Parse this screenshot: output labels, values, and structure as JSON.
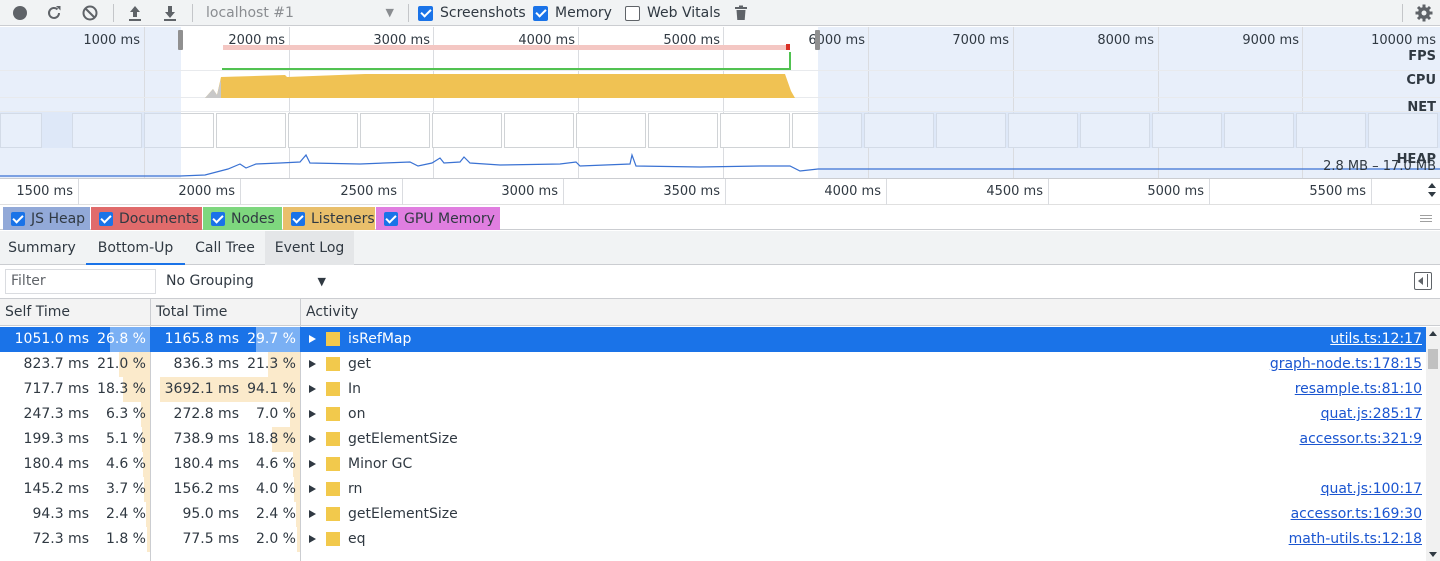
{
  "toolbar": {
    "profile_select": "localhost #1",
    "checkboxes": [
      {
        "label": "Screenshots",
        "checked": true
      },
      {
        "label": "Memory",
        "checked": true
      },
      {
        "label": "Web Vitals",
        "checked": false
      }
    ],
    "icons": [
      "record-icon",
      "reload-icon",
      "clear-icon",
      "upload-icon",
      "download-icon",
      "trash-icon",
      "gear-icon"
    ]
  },
  "overview": {
    "tick_labels": [
      "1000 ms",
      "2000 ms",
      "3000 ms",
      "4000 ms",
      "5000 ms",
      "6000 ms",
      "7000 ms",
      "8000 ms",
      "9000 ms",
      "10000 ms"
    ],
    "tracks": [
      "FPS",
      "CPU",
      "NET",
      "HEAP"
    ],
    "heap_range": "2.8 MB – 17.0 MB"
  },
  "ruler": {
    "labels": [
      "1500 ms",
      "2000 ms",
      "2500 ms",
      "3000 ms",
      "3500 ms",
      "4000 ms",
      "4500 ms",
      "5000 ms",
      "5500 ms"
    ]
  },
  "counters": [
    {
      "label": "JS Heap",
      "color": "#92a9d8"
    },
    {
      "label": "Documents",
      "color": "#e06b6b"
    },
    {
      "label": "Nodes",
      "color": "#7ed77e"
    },
    {
      "label": "Listeners",
      "color": "#e9bf6b"
    },
    {
      "label": "GPU Memory",
      "color": "#e07ee0"
    }
  ],
  "tabs": [
    "Summary",
    "Bottom-Up",
    "Call Tree",
    "Event Log"
  ],
  "active_tab": "Bottom-Up",
  "filter": {
    "placeholder": "Filter"
  },
  "grouping": "No Grouping",
  "columns": {
    "self": "Self Time",
    "total": "Total Time",
    "activity": "Activity"
  },
  "rows": [
    {
      "self_ms": "1051.0 ms",
      "self_pct": "26.8 %",
      "self_frac": 0.268,
      "total_ms": "1165.8 ms",
      "total_pct": "29.7 %",
      "total_frac": 0.297,
      "name": "isRefMap",
      "link": "utils.ts:12:17",
      "selected": true
    },
    {
      "self_ms": "823.7 ms",
      "self_pct": "21.0 %",
      "self_frac": 0.21,
      "total_ms": "836.3 ms",
      "total_pct": "21.3 %",
      "total_frac": 0.213,
      "name": "get",
      "link": "graph-node.ts:178:15"
    },
    {
      "self_ms": "717.7 ms",
      "self_pct": "18.3 %",
      "self_frac": 0.183,
      "total_ms": "3692.1 ms",
      "total_pct": "94.1 %",
      "total_frac": 0.941,
      "name": "In",
      "link": "resample.ts:81:10"
    },
    {
      "self_ms": "247.3 ms",
      "self_pct": "6.3 %",
      "self_frac": 0.063,
      "total_ms": "272.8 ms",
      "total_pct": "7.0 %",
      "total_frac": 0.07,
      "name": "on",
      "link": "quat.js:285:17"
    },
    {
      "self_ms": "199.3 ms",
      "self_pct": "5.1 %",
      "self_frac": 0.051,
      "total_ms": "738.9 ms",
      "total_pct": "18.8 %",
      "total_frac": 0.188,
      "name": "getElementSize",
      "link": "accessor.ts:321:9"
    },
    {
      "self_ms": "180.4 ms",
      "self_pct": "4.6 %",
      "self_frac": 0.046,
      "total_ms": "180.4 ms",
      "total_pct": "4.6 %",
      "total_frac": 0.046,
      "name": "Minor GC",
      "link": ""
    },
    {
      "self_ms": "145.2 ms",
      "self_pct": "3.7 %",
      "self_frac": 0.037,
      "total_ms": "156.2 ms",
      "total_pct": "4.0 %",
      "total_frac": 0.04,
      "name": "rn",
      "link": "quat.js:100:17"
    },
    {
      "self_ms": "94.3 ms",
      "self_pct": "2.4 %",
      "self_frac": 0.024,
      "total_ms": "95.0 ms",
      "total_pct": "2.4 %",
      "total_frac": 0.024,
      "name": "getElementSize",
      "link": "accessor.ts:169:30"
    },
    {
      "self_ms": "72.3 ms",
      "self_pct": "1.8 %",
      "self_frac": 0.018,
      "total_ms": "77.5 ms",
      "total_pct": "2.0 %",
      "total_frac": 0.02,
      "name": "eq",
      "link": "math-utils.ts:12:18"
    }
  ]
}
